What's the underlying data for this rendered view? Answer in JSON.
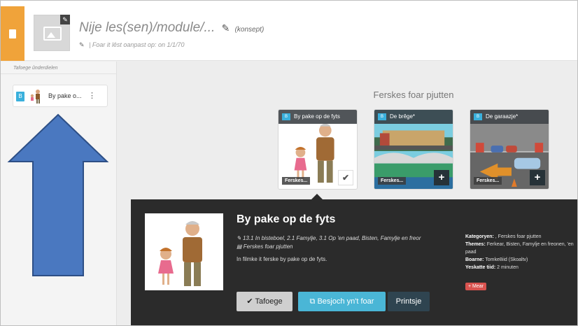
{
  "header": {
    "title": "Nije les(sen)/module/...",
    "status": "(konsept)",
    "subtitle": "| Foar it lêst oanpast op: on 1/1/70"
  },
  "sidebar": {
    "heading": "Tafoege ûnderdielen",
    "items": [
      {
        "type_badge": "B",
        "label": "By pake o..."
      }
    ]
  },
  "collection": {
    "title": "Ferskes foar pjutten",
    "cards": [
      {
        "badge": "B",
        "title": "By pake op de fyts",
        "tag": "Ferskes...",
        "action": "✔"
      },
      {
        "badge": "B",
        "title": "De brêge*",
        "tag": "Ferskes...",
        "action": "+"
      },
      {
        "badge": "B",
        "title": "De garaazje*",
        "tag": "Ferskes...",
        "action": "+"
      }
    ]
  },
  "detail": {
    "title": "By pake op de fyts",
    "categories_line": "13.1 In bisteboel, 2.1 Famylje, 3.1 Op 'en paad, Bisten, Famylje en freor",
    "collection_line": "Ferskes foar pjutten",
    "description": "In filmke it ferske by pake op de fyts.",
    "meta": {
      "categories_label": "Kategoryen:",
      "categories_value": ", Ferskes foar pjutten",
      "themes_label": "Themes:",
      "themes_value": "Ferkear, Bisten, Famylje en freonen, 'en paad",
      "source_label": "Boarne:",
      "source_value": "Tomke8iid (Skoaltv)",
      "time_label": "Yeskatte tiid:",
      "time_value": "2 minuten"
    },
    "more_label": "+ Mear",
    "buttons": {
      "add": "✔ Tafoege",
      "visit": "Besjoch yn't foar",
      "print": "Printsje"
    }
  },
  "colors": {
    "accent_orange": "#f0a33a",
    "accent_blue": "#3ab0dc",
    "arrow_blue": "#4a78c0",
    "panel_dark": "#2b2b2b"
  }
}
